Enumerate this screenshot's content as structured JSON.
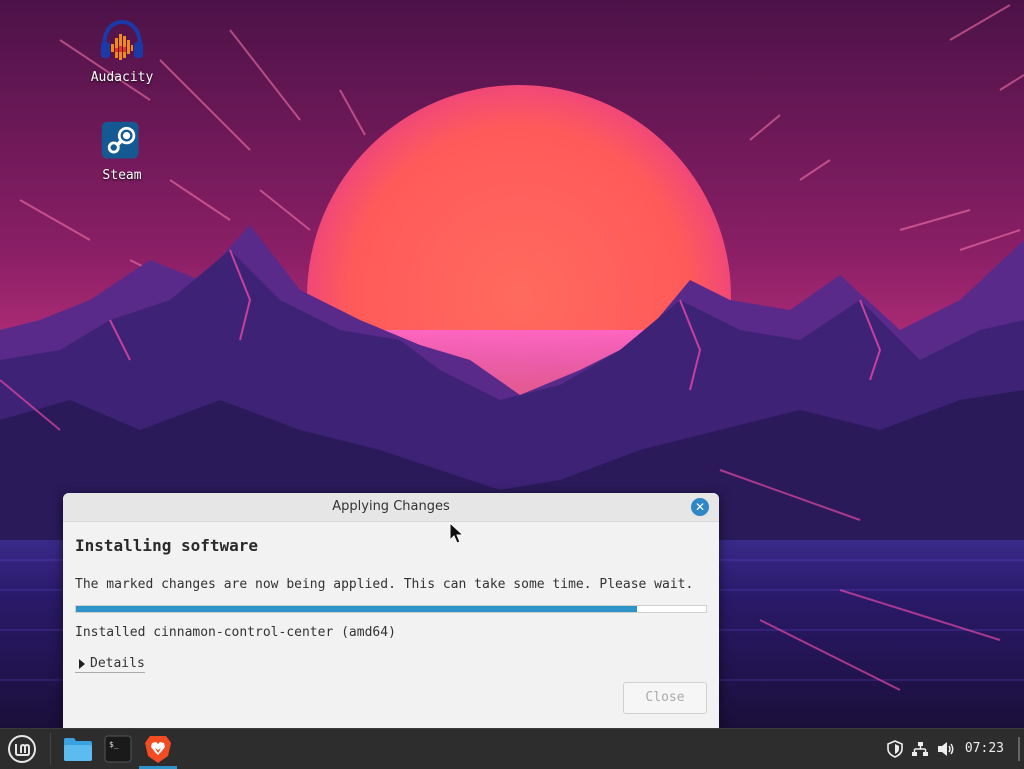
{
  "desktop": {
    "icons": [
      {
        "label": "Audacity",
        "icon": "audacity-icon"
      },
      {
        "label": "Steam",
        "icon": "steam-icon"
      }
    ]
  },
  "dialog": {
    "title": "Applying Changes",
    "heading": "Installing software",
    "message": "The marked changes are now being applied. This can take some time. Please wait.",
    "progress_percent": 89,
    "status": "Installed cinnamon-control-center (amd64)",
    "details_label": "Details",
    "close_label": "Close",
    "close_enabled": false
  },
  "taskbar": {
    "items": [
      {
        "name": "menu",
        "icon": "linux-mint-menu-icon"
      },
      {
        "name": "files",
        "icon": "folder-icon"
      },
      {
        "name": "terminal",
        "icon": "terminal-icon"
      },
      {
        "name": "brave",
        "icon": "brave-browser-icon",
        "active": true
      }
    ],
    "tray": [
      "shield-icon",
      "network-icon",
      "volume-icon"
    ],
    "clock": "07:23"
  },
  "colors": {
    "accent": "#2e93c9",
    "taskbar_bg": "#2d2d2d",
    "dialog_bg": "#f2f2f2"
  }
}
